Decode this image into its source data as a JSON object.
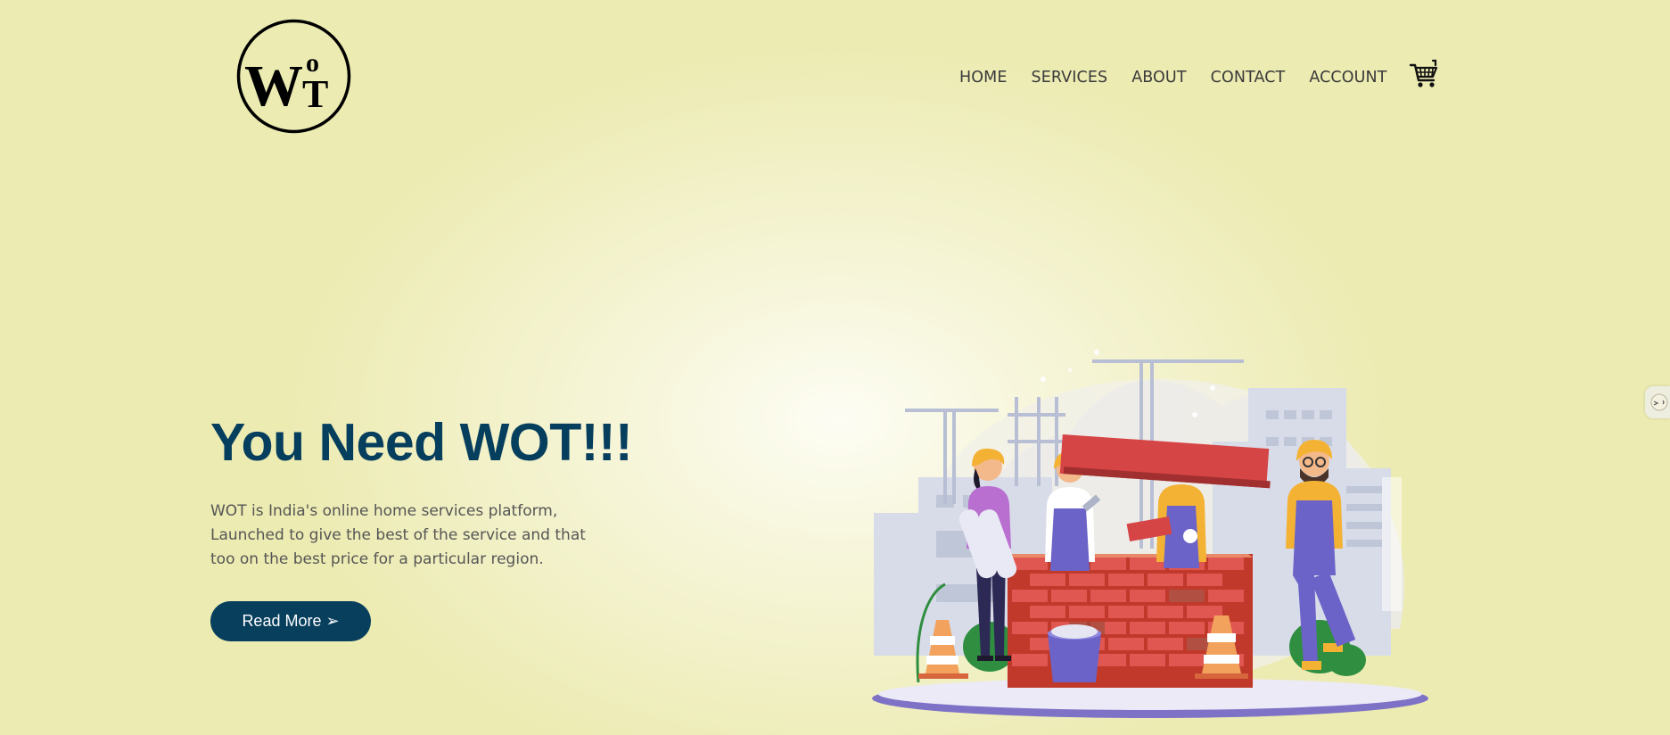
{
  "brand": {
    "logo_text": "WOT",
    "logo_alt": "WOT logo"
  },
  "nav": {
    "items": [
      "HOME",
      "SERVICES",
      "ABOUT",
      "CONTACT",
      "ACCOUNT"
    ],
    "cart_icon": "cart-icon"
  },
  "hero": {
    "title": "You Need WOT!!!",
    "description": "WOT is India's online home services platform, Launched to give the best of the service and that too on the best price for a particular region.",
    "button_label": "Read More ➢"
  },
  "illustration": {
    "subject": "construction-workers-building-brick-wall"
  },
  "colors": {
    "accent": "#063e5d",
    "background": "#efeec0",
    "button": "#073f5d"
  }
}
